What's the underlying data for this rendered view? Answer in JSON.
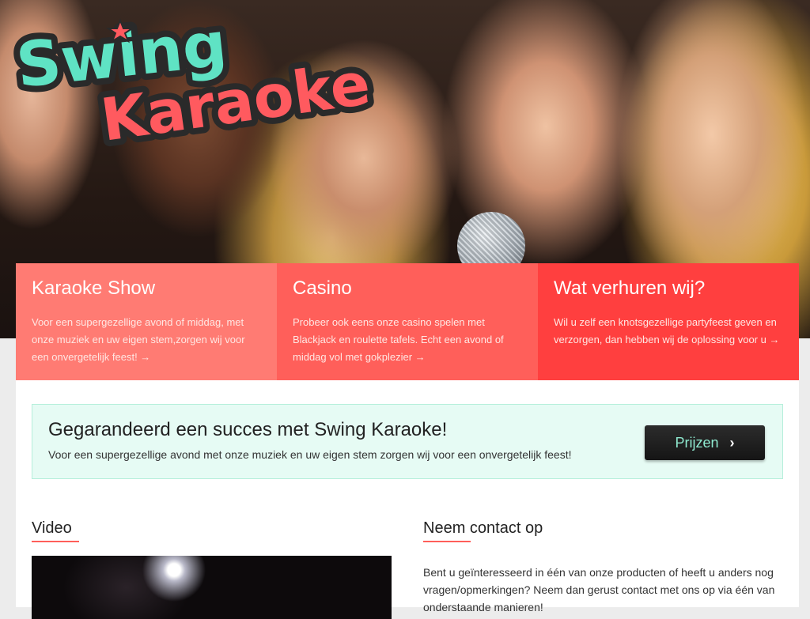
{
  "logo": {
    "line1": "Swing",
    "line2": "Karaoke"
  },
  "features": [
    {
      "title": "Karaoke Show",
      "text": "Voor een supergezellige avond of middag, met onze muziek en uw eigen stem,zorgen wij voor een onvergetelijk feest! →"
    },
    {
      "title": "Casino",
      "text": "Probeer ook eens onze casino spelen met Blackjack en roulette tafels. Echt een avond of middag vol met gokplezier →"
    },
    {
      "title": "Wat verhuren wij?",
      "text": "Wil u zelf een knotsgezellige partyfeest geven en verzorgen, dan hebben wij de oplossing voor u →"
    }
  ],
  "cta": {
    "title": "Gegarandeerd een succes met Swing Karaoke!",
    "text": "Voor een supergezellige avond met onze muziek en uw eigen stem zorgen wij voor een onvergetelijk feest!",
    "button": "Prijzen",
    "button_icon": "chevron-right-icon"
  },
  "video": {
    "title": "Video"
  },
  "contact": {
    "title": "Neem contact op",
    "text": "Bent u geïnteresseerd in één van onze producten of heeft u anders nog vragen/opmerkingen? Neem dan gerust contact met ons op via één van onderstaande manieren!"
  },
  "colors": {
    "feature1": "#ff7b73",
    "feature2": "#ff5f5a",
    "feature3": "#ff3f3f",
    "logo_teal": "#5fe3c4",
    "logo_red": "#ff5a5f",
    "cta_bg": "#e6fbf4",
    "button_text": "#8ee9cf"
  }
}
